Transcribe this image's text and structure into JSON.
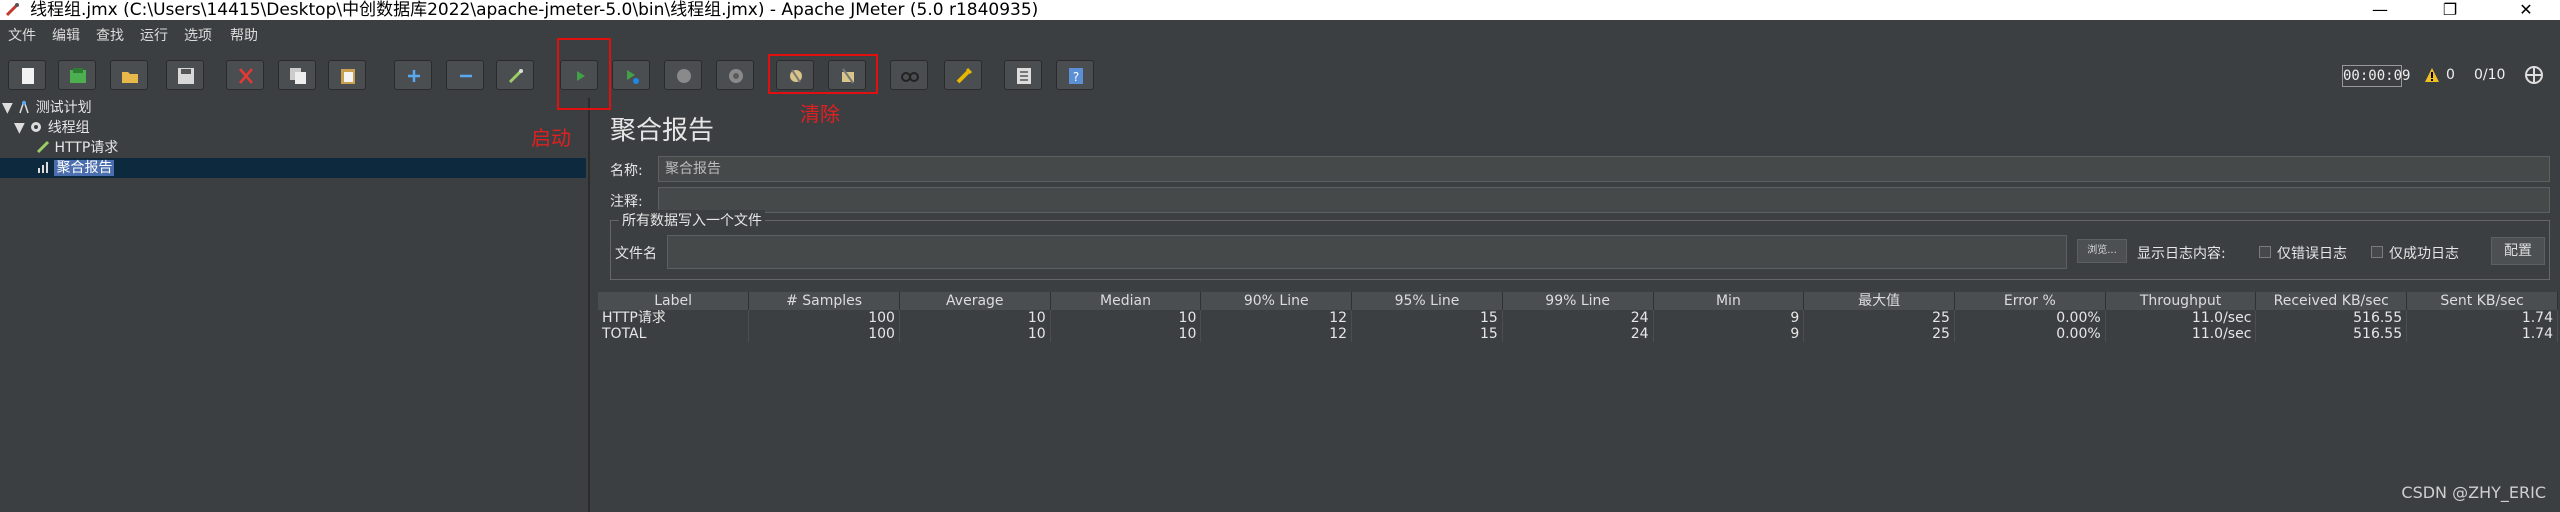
{
  "window": {
    "title": "线程组.jmx (C:\\Users\\14415\\Desktop\\中创数据库2022\\apache-jmeter-5.0\\bin\\线程组.jmx) - Apache JMeter (5.0 r1840935)",
    "minimize": "—",
    "maximize": "❐",
    "close": "✕"
  },
  "menu": [
    "文件",
    "编辑",
    "查找",
    "运行",
    "选项",
    "帮助"
  ],
  "toolbar": {
    "timer": "00:00:09",
    "warnings": "0",
    "threads": "0/10",
    "icons": [
      "new-icon",
      "templates-icon",
      "open-icon",
      "save-icon",
      "cut-icon",
      "copy-icon",
      "paste-icon",
      "expand-icon",
      "collapse-icon",
      "toggle-icon",
      "start-icon",
      "start-no-pauses-icon",
      "stop-icon",
      "shutdown-icon",
      "clear-icon",
      "clear-all-icon",
      "search-icon",
      "reset-search-icon",
      "function-helper-icon",
      "help-icon"
    ]
  },
  "tree": {
    "items": [
      {
        "label": "测试计划",
        "icon": "test-plan-icon"
      },
      {
        "label": "线程组",
        "icon": "thread-group-icon"
      },
      {
        "label": "HTTP请求",
        "icon": "sampler-icon"
      },
      {
        "label": "聚合报告",
        "icon": "listener-icon"
      }
    ]
  },
  "panel": {
    "title": "聚合报告",
    "name_label": "名称:",
    "name_value": "聚合报告",
    "comment_label": "注释:",
    "comment_value": "",
    "file_group_title": "所有数据写入一个文件",
    "file_label": "文件名",
    "file_value": "",
    "browse_label": "浏览...",
    "log_label": "显示日志内容:",
    "errors_only": "仅错误日志",
    "success_only": "仅成功日志",
    "configure": "配置"
  },
  "table": {
    "headers": [
      "Label",
      "# Samples",
      "Average",
      "Median",
      "90% Line",
      "95% Line",
      "99% Line",
      "Min",
      "最大值",
      "Error %",
      "Throughput",
      "Received KB/sec",
      "Sent KB/sec"
    ],
    "rows": [
      [
        "HTTP请求",
        "100",
        "10",
        "10",
        "12",
        "15",
        "24",
        "9",
        "25",
        "0.00%",
        "11.0/sec",
        "516.55",
        "1.74"
      ],
      [
        "TOTAL",
        "100",
        "10",
        "10",
        "12",
        "15",
        "24",
        "9",
        "25",
        "0.00%",
        "11.0/sec",
        "516.55",
        "1.74"
      ]
    ]
  },
  "annotations": {
    "start": "启动",
    "clear": "清除"
  },
  "watermark": "CSDN @ZHY_ERIC",
  "colors": {
    "background": "#3c3f41",
    "selection": "#4b6eaf",
    "annotation": "#e02020"
  }
}
